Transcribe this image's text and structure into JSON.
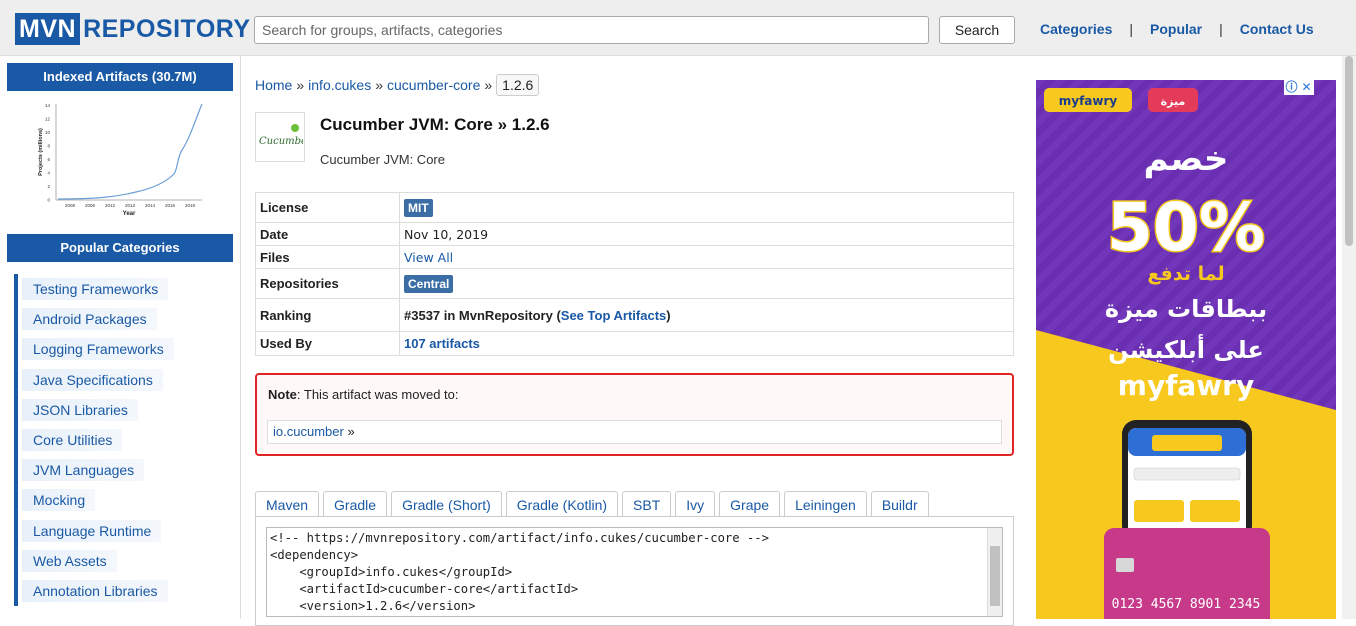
{
  "header": {
    "logo_mvn": "MVN",
    "logo_repo": "REPOSITORY",
    "search_placeholder": "Search for groups, artifacts, categories",
    "search_button": "Search",
    "nav": [
      "Categories",
      "Popular",
      "Contact Us"
    ],
    "nav_separator": "|"
  },
  "sidebar": {
    "indexed_heading": "Indexed Artifacts (30.7M)",
    "graph": {
      "ylabel": "Projects (millions)",
      "xlabel": "Year",
      "yticks": [
        "0",
        "2",
        "4",
        "6",
        "8",
        "10",
        "12",
        "14"
      ],
      "xticks": [
        "2008",
        "2006",
        "2012",
        "2012",
        "2014",
        "2016",
        "2018"
      ]
    },
    "popular_heading": "Popular Categories",
    "categories": [
      "Testing Frameworks",
      "Android Packages",
      "Logging Frameworks",
      "Java Specifications",
      "JSON Libraries",
      "Core Utilities",
      "JVM Languages",
      "Mocking",
      "Language Runtime",
      "Web Assets",
      "Annotation Libraries"
    ]
  },
  "breadcrumb": {
    "items": [
      "Home",
      "info.cukes",
      "cucumber-core"
    ],
    "separator": "»",
    "current": "1.2.6"
  },
  "artifact": {
    "logo_text": "Cucumber",
    "title": "Cucumber JVM: Core » 1.2.6",
    "description": "Cucumber JVM: Core"
  },
  "info": {
    "license_key": "License",
    "license_val": "MIT",
    "date_key": "Date",
    "date_val": "Nov 10, 2019",
    "files_key": "Files",
    "files_val": "View All",
    "repos_key": "Repositories",
    "repos_val": "Central",
    "ranking_key": "Ranking",
    "ranking_prefix": "#3537 in MvnRepository (",
    "ranking_link": "See Top Artifacts",
    "ranking_suffix": ")",
    "usedby_key": "Used By",
    "usedby_val": "107 artifacts"
  },
  "note": {
    "label": "Note",
    "text": ": This artifact was moved to:",
    "link": "io.cucumber",
    "link_arrow": "»"
  },
  "tabs": [
    "Maven",
    "Gradle",
    "Gradle (Short)",
    "Gradle (Kotlin)",
    "SBT",
    "Ivy",
    "Grape",
    "Leiningen",
    "Buildr"
  ],
  "code": {
    "lines": [
      "<!-- https://mvnrepository.com/artifact/info.cukes/cucumber-core -->",
      "<dependency>",
      "    <groupId>info.cukes</groupId>",
      "    <artifactId>cucumber-core</artifactId>",
      "    <version>1.2.6</version>"
    ]
  },
  "ad": {
    "brand": "myfawry",
    "brand_ar": "ميزة",
    "headline_ar": "خصم",
    "percent": "50%",
    "line1_ar": "لما تدفع",
    "line2_ar": "ببطاقات ميزة",
    "line3_ar": "على أبلكيشن",
    "brand_big": "myfawry",
    "card_number": "0123 4567 8901 2345",
    "colors": {
      "purple": "#6a2fb0",
      "yellow": "#f7c81e"
    }
  }
}
